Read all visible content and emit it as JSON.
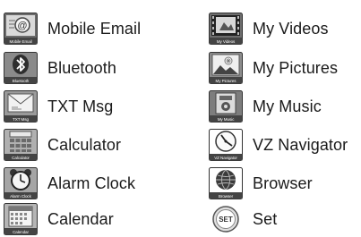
{
  "menu": {
    "left": [
      {
        "label": "Mobile Email",
        "caption": "Mobile Email",
        "icon": "mobile-email-icon"
      },
      {
        "label": "Bluetooth",
        "caption": "Bluetooth",
        "icon": "bluetooth-icon"
      },
      {
        "label": "TXT Msg",
        "caption": "TXT Msg",
        "icon": "txt-msg-icon"
      },
      {
        "label": "Calculator",
        "caption": "Calculator",
        "icon": "calculator-icon"
      },
      {
        "label": "Alarm Clock",
        "caption": "Alarm Clock",
        "icon": "alarm-clock-icon"
      },
      {
        "label": "Calendar",
        "caption": "Calendar",
        "icon": "calendar-icon"
      }
    ],
    "right": [
      {
        "label": "My Videos",
        "caption": "My Videos",
        "icon": "my-videos-icon"
      },
      {
        "label": "My Pictures",
        "caption": "My Pictures",
        "icon": "my-pictures-icon"
      },
      {
        "label": "My Music",
        "caption": "My Music",
        "icon": "my-music-icon"
      },
      {
        "label": "VZ Navigator",
        "caption": "VZ Navigator",
        "icon": "vz-navigator-icon"
      },
      {
        "label": "Browser",
        "caption": "Browser",
        "icon": "browser-icon"
      },
      {
        "label": "Set",
        "caption": "",
        "icon": "settings-icon"
      }
    ]
  }
}
